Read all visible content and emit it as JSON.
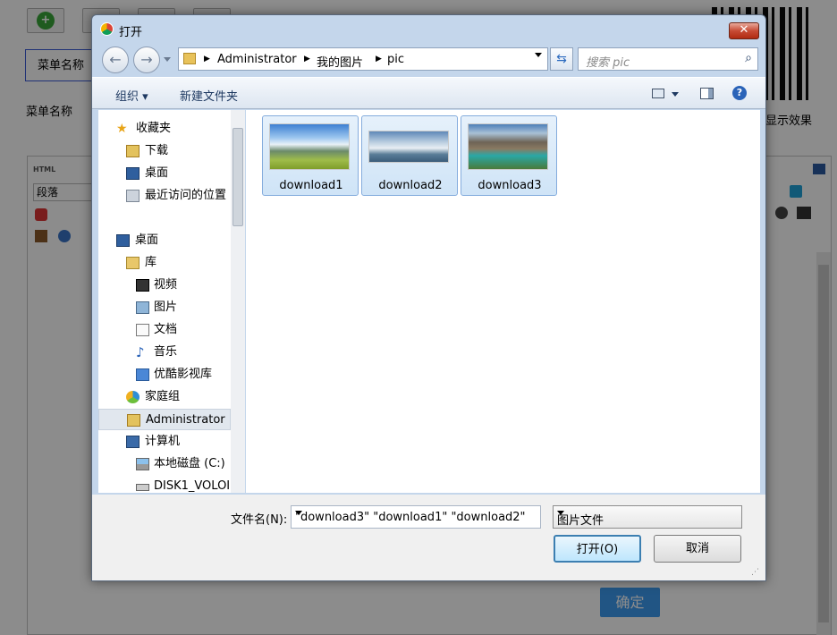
{
  "background": {
    "menu_name_box": "菜单名称",
    "menu_name_label": "菜单名称",
    "show_effect": "显示效果",
    "paragraph_select": "段落",
    "html_label": "HTML",
    "confirm_button": "确定"
  },
  "dialog": {
    "title": "打开",
    "close_label": "✕",
    "address": {
      "crumbs": [
        "Administrator",
        "我的图片",
        "pic"
      ]
    },
    "search_placeholder": "搜索 pic",
    "toolbar": {
      "organize": "组织 ▾",
      "new_folder": "新建文件夹"
    },
    "nav": [
      {
        "label": "收藏夹",
        "icon": "star-icon"
      },
      {
        "label": "下载",
        "icon": "download-folder-icon"
      },
      {
        "label": "桌面",
        "icon": "desktop-icon"
      },
      {
        "label": "最近访问的位置",
        "icon": "recent-places-icon"
      },
      {
        "label": "桌面",
        "icon": "desktop-icon"
      },
      {
        "label": "库",
        "icon": "library-icon"
      },
      {
        "label": "视频",
        "icon": "video-icon"
      },
      {
        "label": "图片",
        "icon": "pictures-icon"
      },
      {
        "label": "文档",
        "icon": "documents-icon"
      },
      {
        "label": "音乐",
        "icon": "music-icon"
      },
      {
        "label": "优酷影视库",
        "icon": "youku-library-icon"
      },
      {
        "label": "家庭组",
        "icon": "homegroup-icon"
      },
      {
        "label": "Administrator",
        "icon": "user-folder-icon"
      },
      {
        "label": "计算机",
        "icon": "computer-icon"
      },
      {
        "label": "本地磁盘 (C:)",
        "icon": "local-disk-icon"
      },
      {
        "label": "DISK1_VOLOI",
        "icon": "removable-disk-icon"
      }
    ],
    "files": [
      "download1",
      "download2",
      "download3"
    ],
    "filename_label": "文件名(N):",
    "filename_value": "\"download3\" \"download1\" \"download2\"",
    "filetype_value": "图片文件",
    "open_button": "打开(O)",
    "cancel_button": "取消"
  }
}
